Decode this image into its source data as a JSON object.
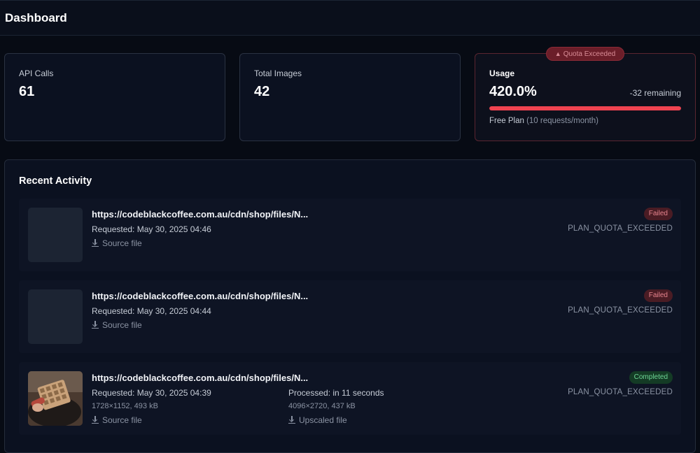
{
  "header": {
    "title": "Dashboard"
  },
  "stats": {
    "api_calls": {
      "label": "API Calls",
      "value": "61"
    },
    "total_images": {
      "label": "Total Images",
      "value": "42"
    },
    "usage": {
      "label": "Usage",
      "value": "420.0%",
      "remaining": "-32 remaining",
      "bar_fill_fraction": 1.0,
      "plan": "Free Plan",
      "plan_detail": "(10 requests/month)",
      "badge": "Quota Exceeded"
    }
  },
  "activity": {
    "heading": "Recent Activity",
    "items": [
      {
        "url": "https://codeblackcoffee.com.au/cdn/shop/files/N...",
        "requested": "Requested: May 30, 2025 04:46",
        "source_link": "Source file",
        "status": "Failed",
        "error": "PLAN_QUOTA_EXCEEDED"
      },
      {
        "url": "https://codeblackcoffee.com.au/cdn/shop/files/N...",
        "requested": "Requested: May 30, 2025 04:44",
        "source_link": "Source file",
        "status": "Failed",
        "error": "PLAN_QUOTA_EXCEEDED"
      },
      {
        "url": "https://codeblackcoffee.com.au/cdn/shop/files/N...",
        "requested": "Requested: May 30, 2025 04:39",
        "source_dims": "1728×1152, 493 kB",
        "source_link": "Source file",
        "processed": "Processed: in 11 seconds",
        "processed_dims": "4096×2720, 437 kB",
        "upscaled_link": "Upscaled file",
        "status": "Completed",
        "error": "PLAN_QUOTA_EXCEEDED"
      }
    ]
  },
  "colors": {
    "background": "#070b14",
    "danger": "#ef4350",
    "success": "#6fd696"
  },
  "icons": {
    "download": "download-icon",
    "warning": "warning-triangle-icon"
  }
}
